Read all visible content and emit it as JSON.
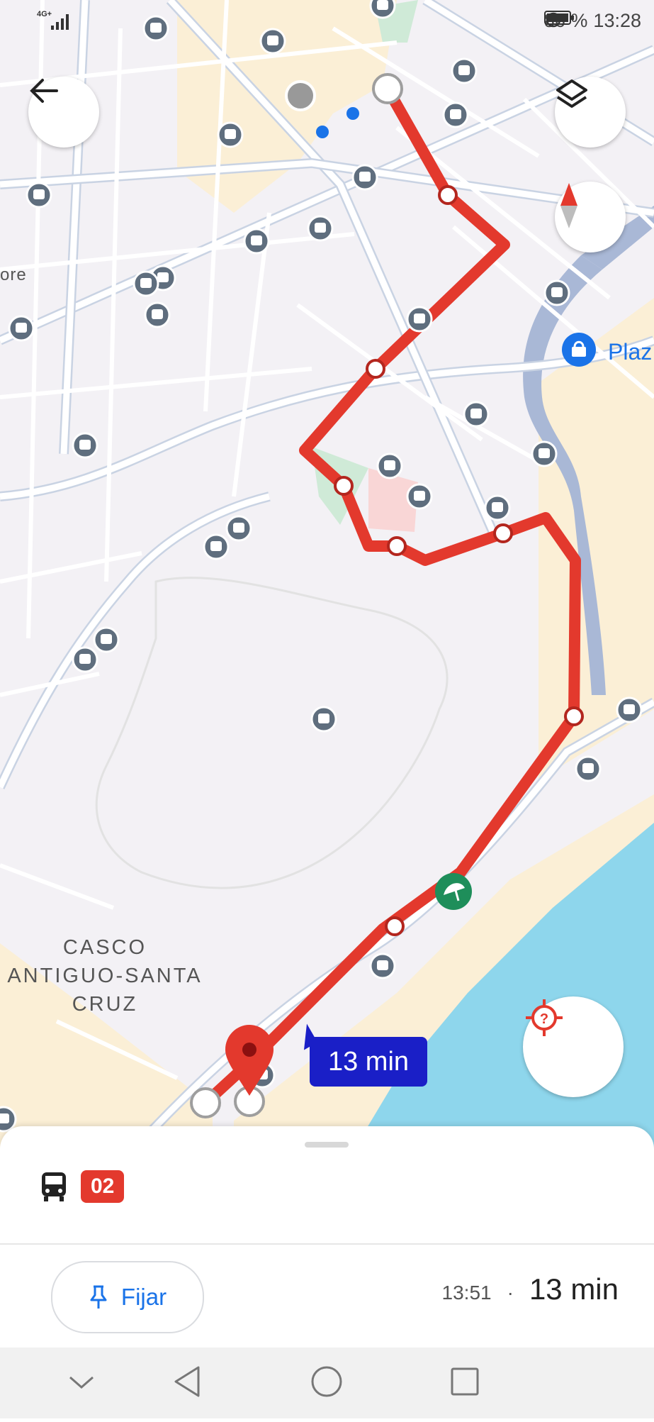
{
  "status_bar": {
    "network": "4G+",
    "battery": "86 %",
    "time": "13:28",
    "icons": [
      "alarm-icon",
      "battery-icon",
      "signal-icon"
    ]
  },
  "map": {
    "labels": {
      "district": [
        "CASCO",
        "ANTIGUO-SANTA",
        "CRUZ"
      ],
      "partial_left": "ore",
      "partial_place": "Plaz"
    },
    "route_color": "#e3392d",
    "duration_callout": "13 min"
  },
  "controls": {
    "back": "back-arrow-icon",
    "layers": "layers-icon",
    "compass": "compass-icon",
    "locate": "locate-icon"
  },
  "sheet": {
    "transit_mode": "bus-icon",
    "route_number": "02",
    "pin_label": "Fijar",
    "arrival_time": "13:51",
    "separator": "·",
    "duration": "13 min"
  },
  "colors": {
    "route": "#e3392d",
    "route_badge": "#e3392d",
    "callout": "#1a1fc7",
    "water": "#8ed6ec",
    "sand": "#fbefd6",
    "link_blue": "#1a73e8"
  },
  "system_nav": [
    "collapse-icon",
    "back-icon",
    "home-icon",
    "recents-icon"
  ]
}
